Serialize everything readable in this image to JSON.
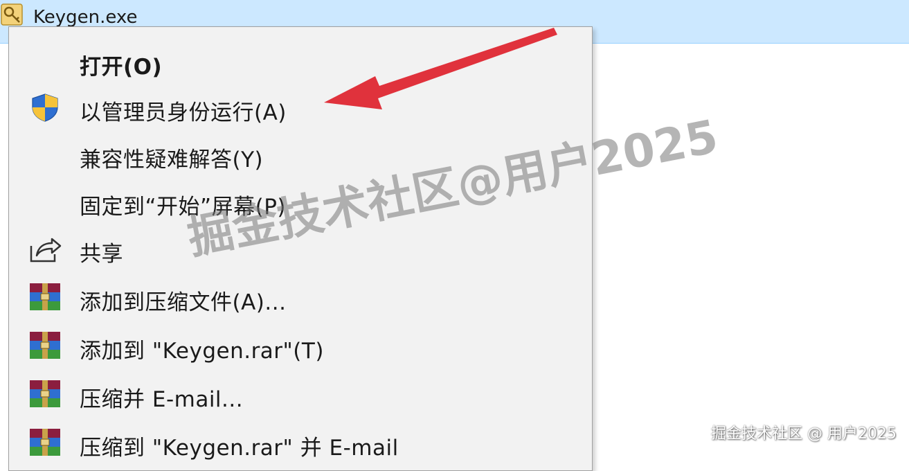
{
  "file": {
    "name": "Keygen.exe",
    "icon": "key-icon"
  },
  "context_menu": {
    "items": [
      {
        "label": "打开(O)",
        "icon": null,
        "bold": true
      },
      {
        "label": "以管理员身份运行(A)",
        "icon": "uac-shield-icon",
        "bold": false
      },
      {
        "label": "兼容性疑难解答(Y)",
        "icon": null,
        "bold": false
      },
      {
        "label": "固定到“开始”屏幕(P)",
        "icon": null,
        "bold": false
      },
      {
        "label": "共享",
        "icon": "share-icon",
        "bold": false
      },
      {
        "label": "添加到压缩文件(A)...",
        "icon": "winrar-icon",
        "bold": false
      },
      {
        "label": "添加到 \"Keygen.rar\"(T)",
        "icon": "winrar-icon",
        "bold": false
      },
      {
        "label": "压缩并 E-mail...",
        "icon": "winrar-icon",
        "bold": false
      },
      {
        "label": "压缩到 \"Keygen.rar\" 并 E-mail",
        "icon": "winrar-icon",
        "bold": false
      }
    ]
  },
  "annotation": {
    "arrow_color": "#e0323c",
    "points_to": "以管理员身份运行(A)"
  },
  "watermark": {
    "center_text": "掘金技术社区@用户2025",
    "corner_text": "掘金技术社区 @ 用户2025"
  },
  "colors": {
    "selection_bg": "#cce8ff",
    "menu_bg": "#f2f2f2",
    "arrow": "#e0323c"
  }
}
